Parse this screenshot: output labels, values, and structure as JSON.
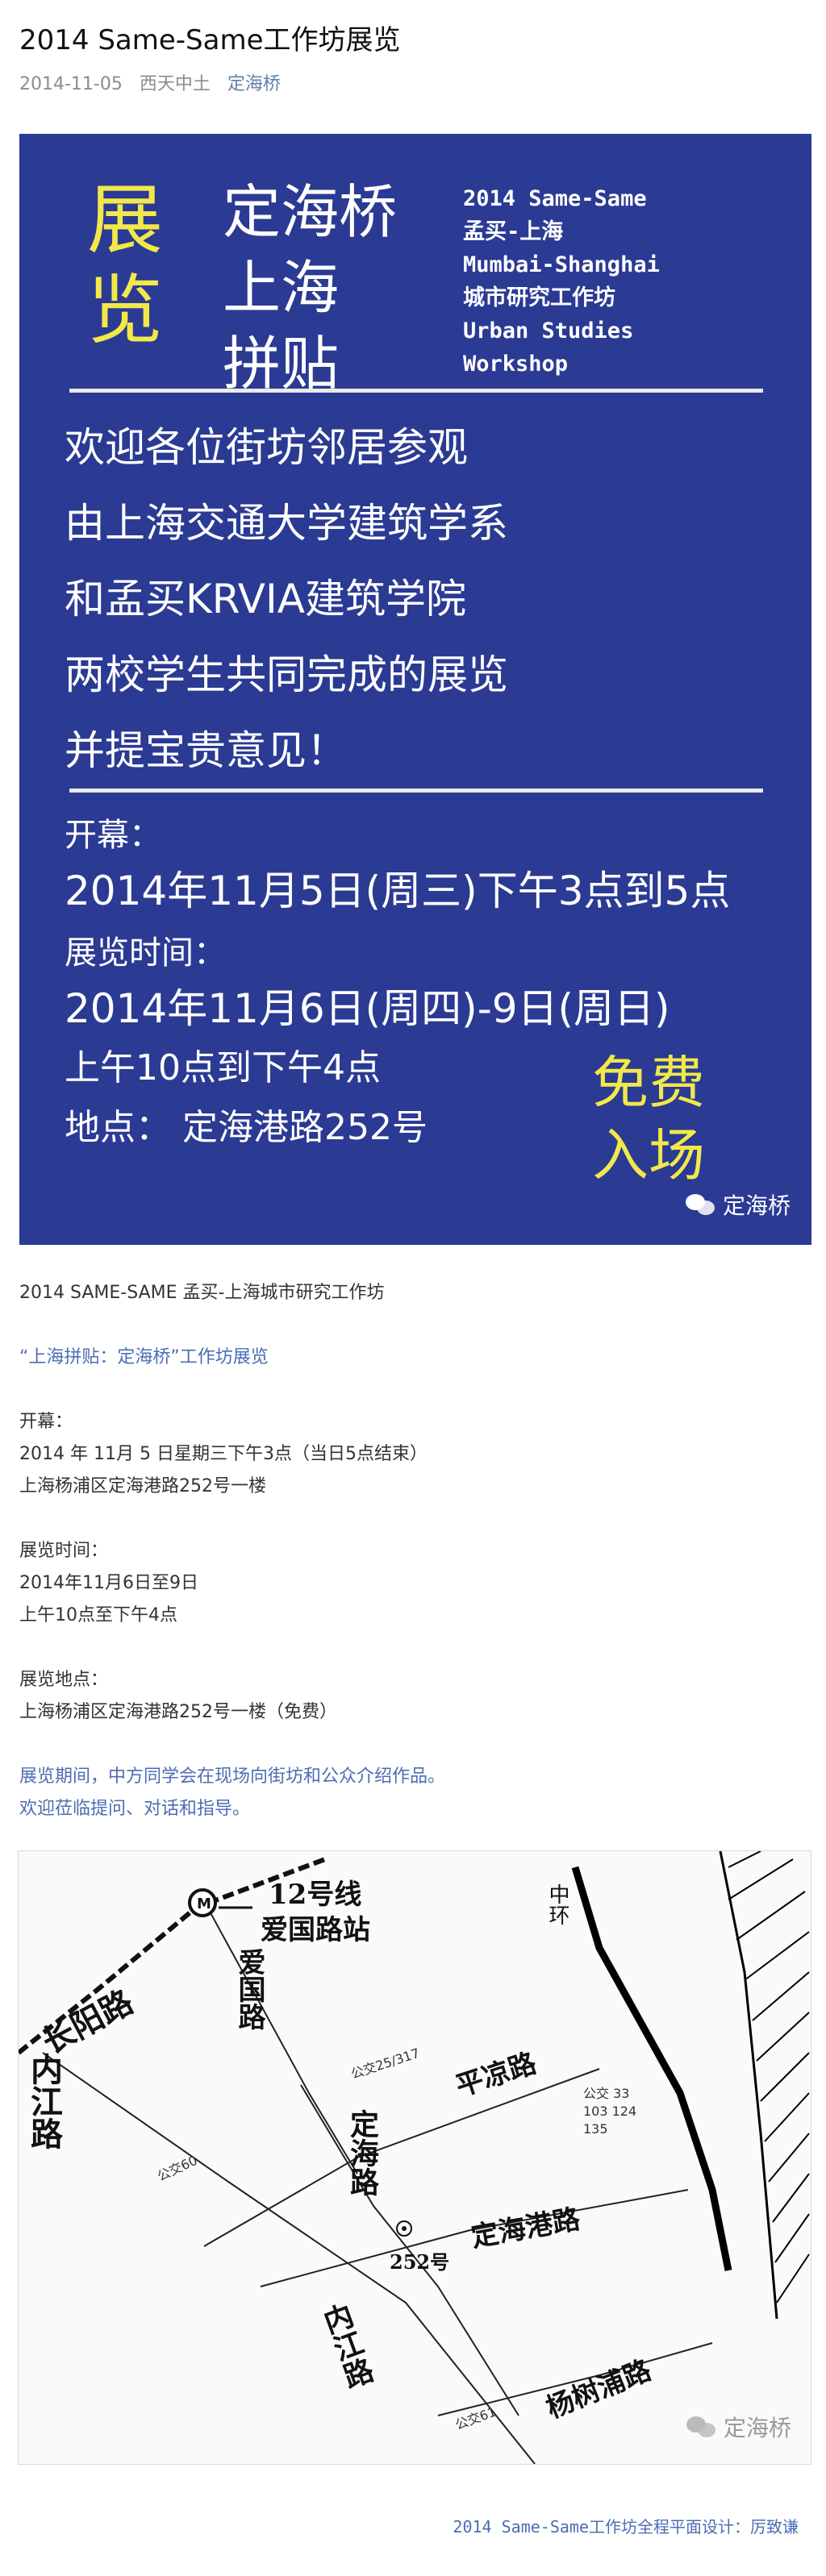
{
  "article": {
    "title": "2014 Same-Same工作坊展览",
    "date": "2014-11-05",
    "source": "西天中土",
    "author": "定海桥"
  },
  "poster": {
    "exhibit_chars": [
      "展",
      "览"
    ],
    "place_lines": [
      "定海桥",
      "上海",
      "拼贴"
    ],
    "en_lines": [
      "2014 Same-Same",
      "孟买-上海",
      "Mumbai-Shanghai",
      "城市研究工作坊",
      "Urban Studies",
      "Workshop"
    ],
    "welcome_lines": [
      "欢迎各位街坊邻居参观",
      "由上海交通大学建筑学系",
      "和孟买KRVIA建筑学院",
      "两校学生共同完成的展览",
      "并提宝贵意见！"
    ],
    "opening_label": "开幕：",
    "opening_value": "2014年11月5日(周三)下午3点到5点",
    "period_label": "展览时间：",
    "period_value_1": "2014年11月6日(周四)-9日(周日)",
    "period_value_2": "上午10点到下午4点",
    "location": "地点：  定海港路252号",
    "free_lines": [
      "免费",
      "入场"
    ],
    "watermark": "定海桥"
  },
  "body": {
    "intro": "2014 SAME-SAME 孟买-上海城市研究工作坊",
    "subtitle": "“上海拼贴：定海桥”工作坊展览",
    "opening_label": "开幕：",
    "opening_time": "2014 年 11月 5 日星期三下午3点（当日5点结束）",
    "opening_place": "上海杨浦区定海港路252号一楼",
    "period_label": "展览时间：",
    "period_dates": "2014年11月6日至9日",
    "period_hours": "上午10点至下午4点",
    "venue_label": "展览地点：",
    "venue": "上海杨浦区定海港路252号一楼（免费）",
    "note_1": "展览期间，中方同学会在现场向街坊和公众介绍作品。",
    "note_2": "欢迎莅临提问、对话和指导。"
  },
  "map": {
    "labels": {
      "changyang": "长阳路",
      "neijiang_top": "内江路",
      "line12": "12号线",
      "aiguo_station": "爱国路站",
      "aiguo_road": "爱国路",
      "pingliang": "平凉路",
      "dinghai": "定海路",
      "dinghaigang": "定海港路",
      "no252": "252号",
      "neijiang_bottom": "内江路",
      "yangshupu": "杨树浦路",
      "zhonghuan": "中环",
      "bus_25": "公交25/317",
      "bus_60": "公交60",
      "bus_61": "公交61",
      "bus_group": "公交 33 103 124 135"
    },
    "watermark": "定海桥"
  },
  "footer": "2014 Same-Same工作坊全程平面设计：厉致谦"
}
